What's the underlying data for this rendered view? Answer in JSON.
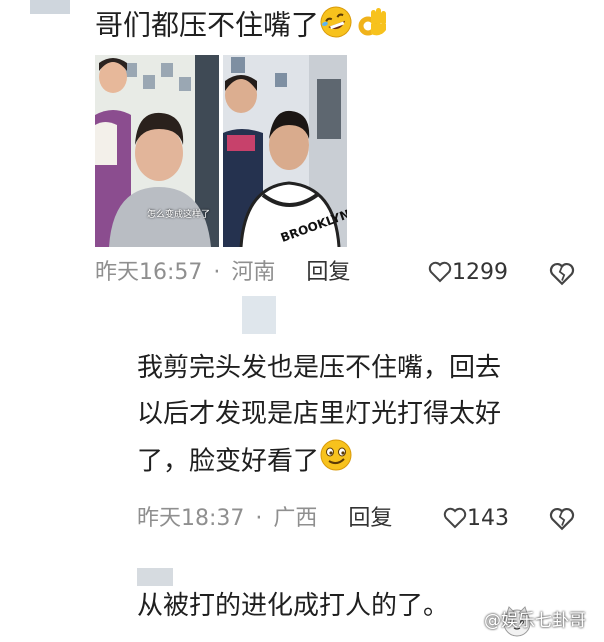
{
  "comments": [
    {
      "text": "哥们都压不住嘴了",
      "time": "昨天16:57",
      "dot": "·",
      "location": "河南",
      "reply_label": "回复",
      "likes": "1299",
      "photo_caption": "怎么变成这样了"
    },
    {
      "lines": [
        "我剪完头发也是压不住嘴，回去",
        "以后才发现是店里灯光打得太好",
        "了，脸变好看了"
      ],
      "time": "昨天18:37",
      "dot": "·",
      "location": "广西",
      "reply_label": "回复",
      "likes": "143"
    },
    {
      "text": "从被打的进化成打人的了。"
    }
  ],
  "jersey_text": "BROOKLYN",
  "watermark": "@娱乐七卦哥",
  "icons": {
    "emoji_laugh": "rofl-emoji-icon",
    "emoji_ok": "ok-hand-emoji-icon",
    "emoji_smug": "smirk-emoji-icon",
    "like": "heart-outline-icon",
    "dislike": "broken-heart-icon"
  },
  "colors": {
    "meta": "#8f8f8f",
    "text": "#1f1f1f",
    "emoji_yellow": "#f7c21d"
  }
}
